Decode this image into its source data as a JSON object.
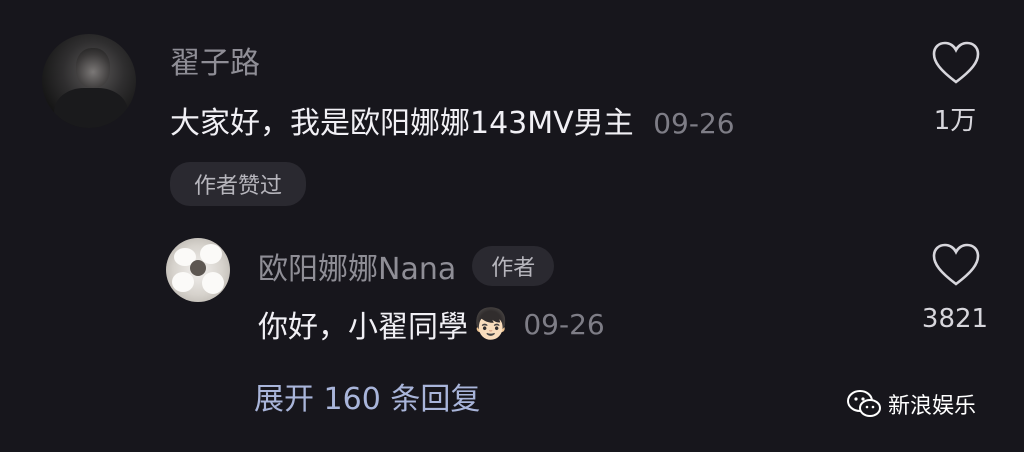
{
  "comment": {
    "username": "翟子路",
    "text": "大家好，我是欧阳娜娜143MV男主",
    "date": "09-26",
    "like_count": "1万",
    "author_liked_badge": "作者赞过"
  },
  "reply": {
    "username": "欧阳娜娜Nana",
    "author_badge": "作者",
    "text": "你好，小翟同學",
    "emoji": "👦🏻",
    "date": "09-26",
    "like_count": "3821"
  },
  "expand_replies": "展开 160 条回复",
  "watermark": {
    "icon": "wechat-icon",
    "text": "新浪娱乐"
  },
  "icons": {
    "like": "heart-outline-icon"
  },
  "colors": {
    "background": "#17161c",
    "link_blue": "#a9b5da"
  }
}
